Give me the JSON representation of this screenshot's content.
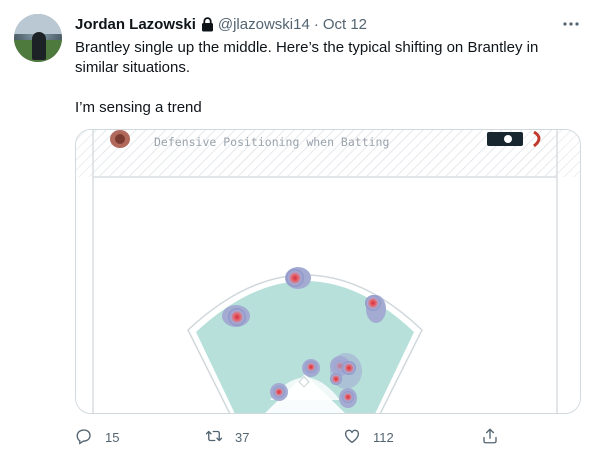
{
  "author": {
    "display_name": "Jordan Lazowski",
    "handle": "@jlazowski14",
    "protected_icon": "lock-icon",
    "avatar": "profile-photo"
  },
  "meta": {
    "separator": "·",
    "date": "Oct 12",
    "more_icon": "more-icon"
  },
  "text": {
    "line1": "Brantley single up the middle. Here’s the typical shifting on Brantley in similar situations.",
    "line2": "I’m sensing a trend"
  },
  "media": {
    "banner_title": "Defensive Positioning when Batting",
    "image_kind": "defensive-positioning-heatmap"
  },
  "actions": {
    "reply": {
      "icon": "reply-icon",
      "count": "15"
    },
    "retweet": {
      "icon": "retweet-icon",
      "count": "37"
    },
    "like": {
      "icon": "like-icon",
      "count": "112"
    },
    "share": {
      "icon": "share-icon"
    }
  },
  "colors": {
    "text_primary": "#0f1419",
    "text_secondary": "#536471",
    "border": "#cfd9de",
    "field_teal": "#b6e0d9",
    "heat_red": "#d62d3a",
    "heat_blue": "#8a93c4"
  }
}
